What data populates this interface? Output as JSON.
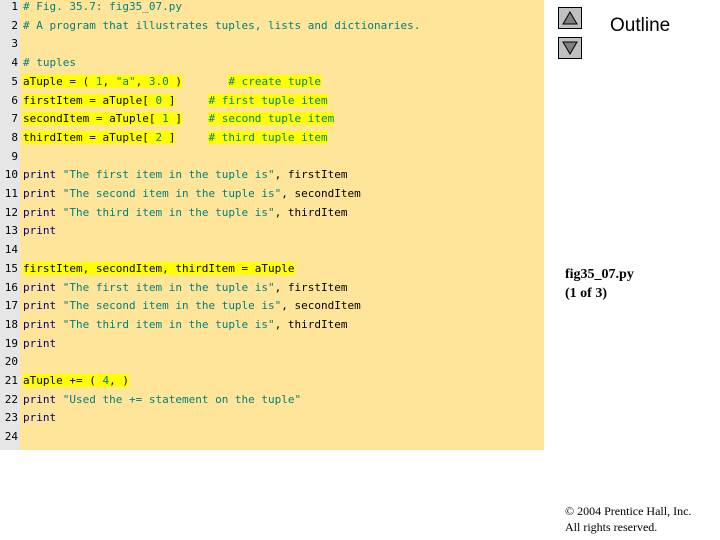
{
  "outline_label": "Outline",
  "file_info": {
    "name": "fig35_07.py",
    "page": "(1 of 3)"
  },
  "copyright": {
    "line1": "© 2004 Prentice Hall, Inc.",
    "line2": "All rights reserved."
  },
  "nav": {
    "up_icon": "triangle-up-icon",
    "down_icon": "triangle-down-icon"
  },
  "colors": {
    "code_bg": "#ffe599",
    "highlight": "#ffff00",
    "keyword": "#000080",
    "string": "#008080"
  },
  "lines": [
    {
      "n": "1",
      "parts": [
        {
          "t": "# Fig. 35.7: fig35_07.py",
          "c": "cmt"
        }
      ]
    },
    {
      "n": "2",
      "parts": [
        {
          "t": "# A program that illustrates tuples, lists and dictionaries.",
          "c": "cmt"
        }
      ]
    },
    {
      "n": "3",
      "parts": []
    },
    {
      "n": "4",
      "parts": [
        {
          "t": "# tuples",
          "c": "cmt"
        }
      ]
    },
    {
      "n": "5",
      "parts": [
        {
          "t": "aTuple = ( ",
          "c": "plain",
          "h": true
        },
        {
          "t": "1",
          "c": "num",
          "h": true
        },
        {
          "t": ", ",
          "c": "plain",
          "h": true
        },
        {
          "t": "\"a\"",
          "c": "str",
          "h": true
        },
        {
          "t": ", ",
          "c": "plain",
          "h": true
        },
        {
          "t": "3.0",
          "c": "num",
          "h": true
        },
        {
          "t": " )",
          "c": "plain",
          "h": true
        },
        {
          "t": "       ",
          "c": "plain"
        },
        {
          "t": "# create tuple",
          "c": "cmt",
          "h": true
        }
      ]
    },
    {
      "n": "6",
      "parts": [
        {
          "t": "firstItem = aTuple[ ",
          "c": "plain",
          "h": true
        },
        {
          "t": "0",
          "c": "num",
          "h": true
        },
        {
          "t": " ]",
          "c": "plain",
          "h": true
        },
        {
          "t": "     ",
          "c": "plain"
        },
        {
          "t": "# first tuple item",
          "c": "cmt",
          "h": true
        }
      ]
    },
    {
      "n": "7",
      "parts": [
        {
          "t": "secondItem = aTuple[ ",
          "c": "plain",
          "h": true
        },
        {
          "t": "1",
          "c": "num",
          "h": true
        },
        {
          "t": " ]",
          "c": "plain",
          "h": true
        },
        {
          "t": "    ",
          "c": "plain"
        },
        {
          "t": "# second tuple item",
          "c": "cmt",
          "h": true
        }
      ]
    },
    {
      "n": "8",
      "parts": [
        {
          "t": "thirdItem = aTuple[ ",
          "c": "plain",
          "h": true
        },
        {
          "t": "2",
          "c": "num",
          "h": true
        },
        {
          "t": " ]",
          "c": "plain",
          "h": true
        },
        {
          "t": "     ",
          "c": "plain"
        },
        {
          "t": "# third tuple item",
          "c": "cmt",
          "h": true
        }
      ]
    },
    {
      "n": "9",
      "parts": []
    },
    {
      "n": "10",
      "parts": [
        {
          "t": "print",
          "c": "kw"
        },
        {
          "t": " ",
          "c": "plain"
        },
        {
          "t": "\"The first item in the tuple is\"",
          "c": "str"
        },
        {
          "t": ", firstItem",
          "c": "plain"
        }
      ]
    },
    {
      "n": "11",
      "parts": [
        {
          "t": "print",
          "c": "kw"
        },
        {
          "t": " ",
          "c": "plain"
        },
        {
          "t": "\"The second item in the tuple is\"",
          "c": "str"
        },
        {
          "t": ", secondItem",
          "c": "plain"
        }
      ]
    },
    {
      "n": "12",
      "parts": [
        {
          "t": "print",
          "c": "kw"
        },
        {
          "t": " ",
          "c": "plain"
        },
        {
          "t": "\"The third item in the tuple is\"",
          "c": "str"
        },
        {
          "t": ", thirdItem",
          "c": "plain"
        }
      ]
    },
    {
      "n": "13",
      "parts": [
        {
          "t": "print",
          "c": "kw"
        }
      ]
    },
    {
      "n": "14",
      "parts": []
    },
    {
      "n": "15",
      "parts": [
        {
          "t": "firstItem, secondItem, thirdItem = aTuple",
          "c": "plain",
          "h": true
        }
      ]
    },
    {
      "n": "16",
      "parts": [
        {
          "t": "print",
          "c": "kw"
        },
        {
          "t": " ",
          "c": "plain"
        },
        {
          "t": "\"The first item in the tuple is\"",
          "c": "str"
        },
        {
          "t": ", firstItem",
          "c": "plain"
        }
      ]
    },
    {
      "n": "17",
      "parts": [
        {
          "t": "print",
          "c": "kw"
        },
        {
          "t": " ",
          "c": "plain"
        },
        {
          "t": "\"The second item in the tuple is\"",
          "c": "str"
        },
        {
          "t": ", secondItem",
          "c": "plain"
        }
      ]
    },
    {
      "n": "18",
      "parts": [
        {
          "t": "print",
          "c": "kw"
        },
        {
          "t": " ",
          "c": "plain"
        },
        {
          "t": "\"The third item in the tuple is\"",
          "c": "str"
        },
        {
          "t": ", thirdItem",
          "c": "plain"
        }
      ]
    },
    {
      "n": "19",
      "parts": [
        {
          "t": "print",
          "c": "kw"
        }
      ]
    },
    {
      "n": "20",
      "parts": []
    },
    {
      "n": "21",
      "parts": [
        {
          "t": "aTuple += ( ",
          "c": "plain",
          "h": true
        },
        {
          "t": "4",
          "c": "num",
          "h": true
        },
        {
          "t": ", )",
          "c": "plain",
          "h": true
        }
      ]
    },
    {
      "n": "22",
      "parts": [
        {
          "t": "print",
          "c": "kw"
        },
        {
          "t": " ",
          "c": "plain"
        },
        {
          "t": "\"Used the += statement on the tuple\"",
          "c": "str"
        }
      ]
    },
    {
      "n": "23",
      "parts": [
        {
          "t": "print",
          "c": "kw"
        }
      ]
    },
    {
      "n": "24",
      "parts": []
    }
  ]
}
